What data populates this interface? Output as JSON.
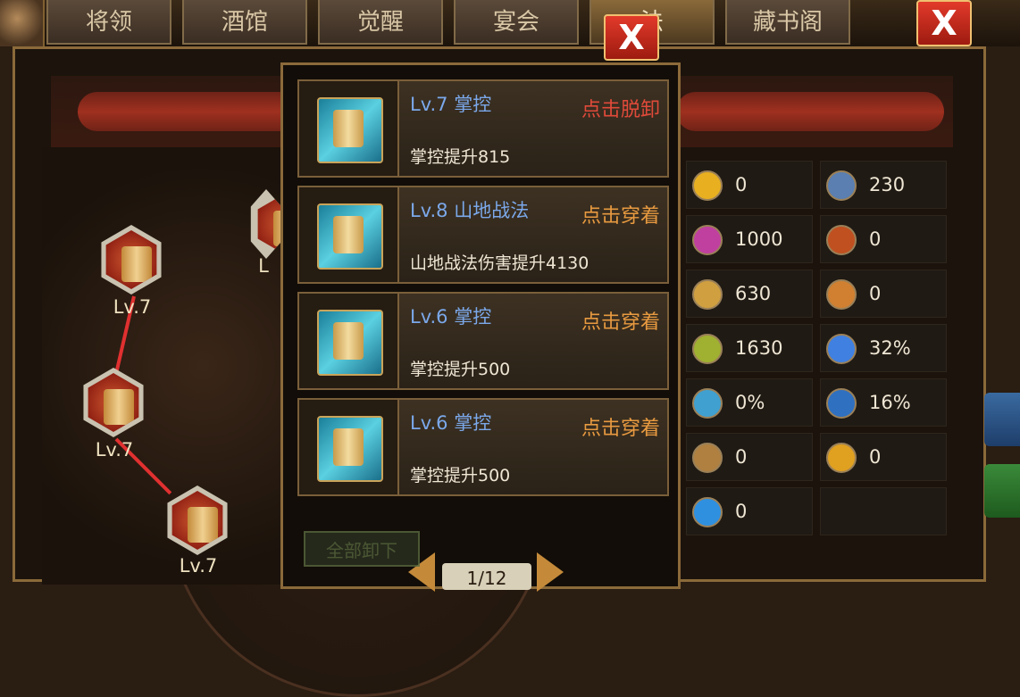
{
  "tabs": [
    {
      "label": "将领"
    },
    {
      "label": "酒馆"
    },
    {
      "label": "觉醒"
    },
    {
      "label": "宴会"
    },
    {
      "label": "法"
    },
    {
      "label": "藏书阁"
    }
  ],
  "tree": {
    "nodes": [
      {
        "label": "Lv.7"
      },
      {
        "label": "Lv.7"
      },
      {
        "label": "Lv.7"
      },
      {
        "label": "L"
      }
    ]
  },
  "popup": {
    "cards": [
      {
        "title": "Lv.7 掌控",
        "action": "点击脱卸",
        "action_color": "#e04a3a",
        "desc": "掌控提升815"
      },
      {
        "title": "Lv.8 山地战法",
        "action": "点击穿着",
        "action_color": "#e89a40",
        "desc": "山地战法伤害提升4130"
      },
      {
        "title": "Lv.6 掌控",
        "action": "点击穿着",
        "action_color": "#e89a40",
        "desc": "掌控提升500"
      },
      {
        "title": "Lv.6 掌控",
        "action": "点击穿着",
        "action_color": "#e89a40",
        "desc": "掌控提升500"
      }
    ],
    "pager": "1/12",
    "unequip_all": "全部卸下"
  },
  "stats": [
    {
      "icon": "lightning-icon",
      "value": "0",
      "color": "#e8b020"
    },
    {
      "icon": "shield-icon",
      "value": "230",
      "color": "#5a7fb0"
    },
    {
      "icon": "burst-icon",
      "value": "1000",
      "color": "#c040a0"
    },
    {
      "icon": "fire-warrior-icon",
      "value": "0",
      "color": "#c05020"
    },
    {
      "icon": "hammer-icon",
      "value": "630",
      "color": "#d0a040"
    },
    {
      "icon": "fist-icon",
      "value": "0",
      "color": "#d08030"
    },
    {
      "icon": "scroll-icon",
      "value": "1630",
      "color": "#a0b030"
    },
    {
      "icon": "wind-icon",
      "value": "32%",
      "color": "#4080e0"
    },
    {
      "icon": "arrow-icon",
      "value": "0%",
      "color": "#40a0d0"
    },
    {
      "icon": "sword-icon",
      "value": "16%",
      "color": "#3070c0"
    },
    {
      "icon": "beast-icon",
      "value": "0",
      "color": "#b08040"
    },
    {
      "icon": "sun-icon",
      "value": "0",
      "color": "#e0a020"
    },
    {
      "icon": "swirl-icon",
      "value": "0",
      "color": "#3090e0"
    }
  ]
}
